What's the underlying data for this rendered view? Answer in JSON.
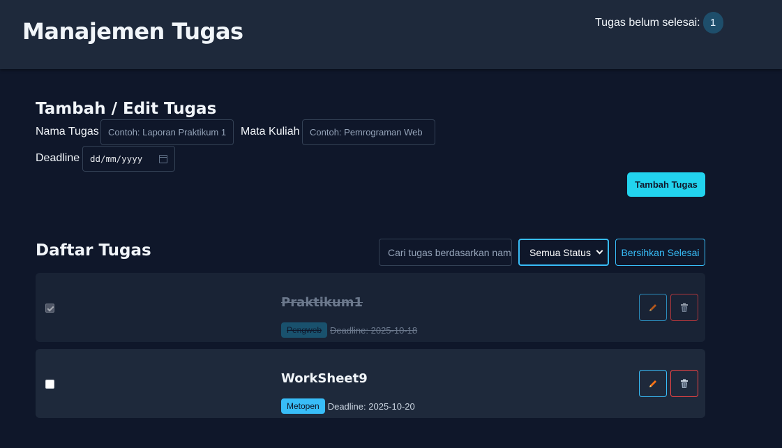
{
  "header": {
    "title": "Manajemen Tugas",
    "pending_label": "Tugas belum selesai:",
    "pending_count": "1"
  },
  "form": {
    "title": "Tambah / Edit Tugas",
    "name_label": "Nama Tugas",
    "name_placeholder": "Contoh: Laporan Praktikum 1",
    "course_label": "Mata Kuliah",
    "course_placeholder": "Contoh: Pemrograman Web",
    "deadline_label": "Deadline",
    "deadline_placeholder": "dd/mm/yyyy",
    "submit_label": "Tambah Tugas"
  },
  "list": {
    "title": "Daftar Tugas",
    "search_placeholder": "Cari tugas berdasarkan nama",
    "filter_value": "Semua Status",
    "clear_label": "Bersihkan Selesai",
    "deadline_prefix": "Deadline:",
    "tasks": [
      {
        "name": "Praktikum1",
        "course": "Pengweb",
        "deadline": "2025-10-18",
        "done": true
      },
      {
        "name": "WorkSheet9",
        "course": "Metopen",
        "deadline": "2025-10-20",
        "done": false
      }
    ]
  },
  "icons": {
    "edit": "pencil-icon",
    "delete": "trash-icon",
    "calendar": "calendar-icon",
    "dropdown": "chevron-down-icon"
  },
  "colors": {
    "accent": "#22d3ee",
    "link": "#38bdf8",
    "danger": "#ef4444",
    "surface": "#1e293b",
    "background": "#0f172a"
  }
}
